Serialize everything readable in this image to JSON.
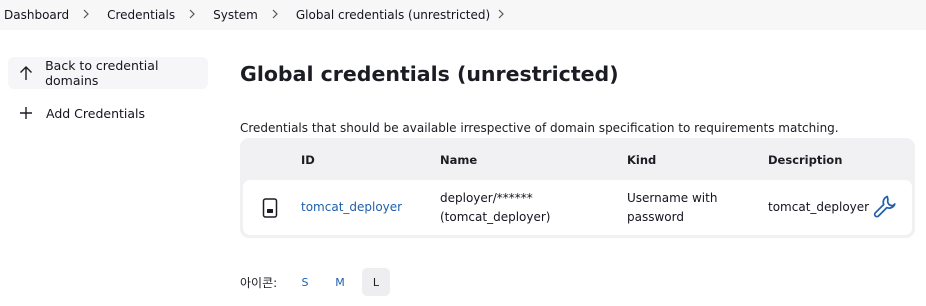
{
  "breadcrumb": {
    "items": [
      "Dashboard",
      "Credentials",
      "System",
      "Global credentials (unrestricted)"
    ]
  },
  "sidebar": {
    "items": [
      {
        "label": "Back to credential domains",
        "icon": "arrow-up-icon"
      },
      {
        "label": "Add Credentials",
        "icon": "plus-icon"
      }
    ]
  },
  "main": {
    "title": "Global credentials (unrestricted)",
    "description": "Credentials that should be available irrespective of domain specification to requirements matching."
  },
  "table": {
    "columns": [
      "ID",
      "Name",
      "Kind",
      "Description"
    ],
    "rows": [
      {
        "id": "tomcat_deployer",
        "name_line1": "deployer/******",
        "name_line2": "(tomcat_deployer)",
        "kind_line1": "Username with",
        "kind_line2": "password",
        "description": "tomcat_deployer"
      }
    ]
  },
  "icon_size": {
    "label": "아이콘:",
    "options": [
      "S",
      "M",
      "L"
    ],
    "selected": "L"
  },
  "colors": {
    "link": "#1f5fad",
    "accent": "#1f5fad",
    "table_bg": "#f1f1f3"
  }
}
